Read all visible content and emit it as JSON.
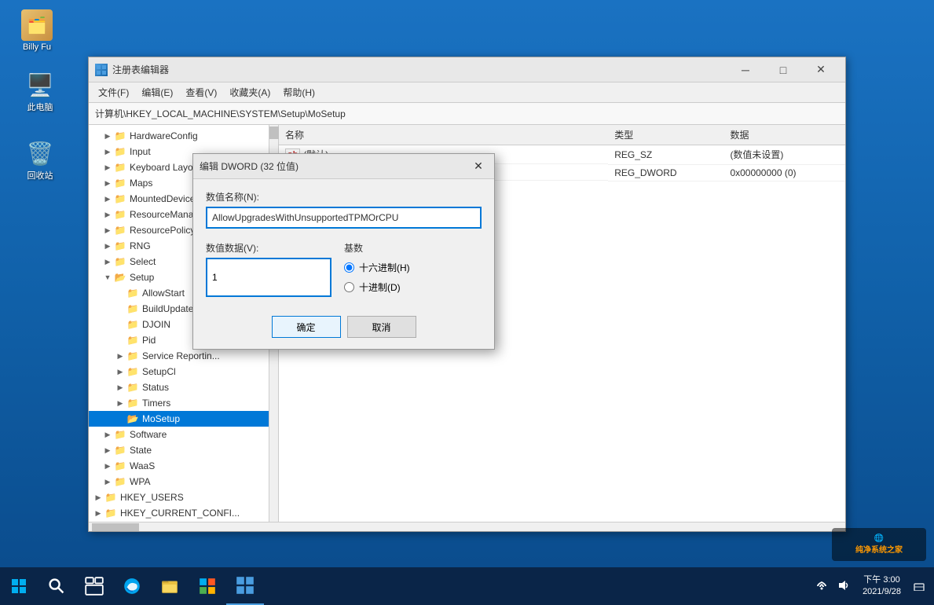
{
  "desktop": {
    "icons": [
      {
        "id": "computer",
        "label": "此电脑",
        "color": "#4a9de0"
      },
      {
        "id": "recycle",
        "label": "回收站",
        "color": "#888"
      }
    ],
    "user": "Billy Fu"
  },
  "registry_window": {
    "title": "注册表编辑器",
    "address": "计算机\\HKEY_LOCAL_MACHINE\\SYSTEM\\Setup\\MoSetup",
    "menu": [
      "文件(F)",
      "编辑(E)",
      "查看(V)",
      "收藏夹(A)",
      "帮助(H)"
    ],
    "columns": [
      "名称",
      "类型",
      "数据"
    ],
    "rows": [
      {
        "name": "(默认)",
        "type": "REG_SZ",
        "data": "(数值未设置)"
      },
      {
        "name": "AllowUpgradesWithUnsupportedTPMOrCPU",
        "type": "REG_DWORD",
        "data": "0x00000000 (0)"
      }
    ],
    "tree": {
      "items": [
        {
          "label": "HardwareConfig",
          "indent": 1,
          "arrow": "▶"
        },
        {
          "label": "Input",
          "indent": 1,
          "arrow": "▶"
        },
        {
          "label": "Keyboard Layout",
          "indent": 1,
          "arrow": "▶"
        },
        {
          "label": "Maps",
          "indent": 1,
          "arrow": "▶"
        },
        {
          "label": "MountedDevices",
          "indent": 1,
          "arrow": "▶"
        },
        {
          "label": "ResourceManager",
          "indent": 1,
          "arrow": "▶"
        },
        {
          "label": "ResourcePolicySto...",
          "indent": 1,
          "arrow": "▶"
        },
        {
          "label": "RNG",
          "indent": 1,
          "arrow": "▶"
        },
        {
          "label": "Select",
          "indent": 1,
          "arrow": "▶"
        },
        {
          "label": "Setup",
          "indent": 1,
          "arrow": "▼"
        },
        {
          "label": "AllowStart",
          "indent": 2,
          "arrow": ""
        },
        {
          "label": "BuildUpdate",
          "indent": 2,
          "arrow": ""
        },
        {
          "label": "DJOIN",
          "indent": 2,
          "arrow": ""
        },
        {
          "label": "Pid",
          "indent": 2,
          "arrow": ""
        },
        {
          "label": "Service Reportin...",
          "indent": 2,
          "arrow": "▶"
        },
        {
          "label": "SetupCl",
          "indent": 2,
          "arrow": "▶"
        },
        {
          "label": "Status",
          "indent": 2,
          "arrow": "▶"
        },
        {
          "label": "Timers",
          "indent": 2,
          "arrow": "▶"
        },
        {
          "label": "MoSetup",
          "indent": 2,
          "arrow": "",
          "selected": true
        },
        {
          "label": "Software",
          "indent": 1,
          "arrow": "▶"
        },
        {
          "label": "State",
          "indent": 1,
          "arrow": "▶"
        },
        {
          "label": "WaaS",
          "indent": 1,
          "arrow": "▶"
        },
        {
          "label": "WPA",
          "indent": 1,
          "arrow": "▶"
        },
        {
          "label": "HKEY_USERS",
          "indent": 0,
          "arrow": "▶"
        },
        {
          "label": "HKEY_CURRENT_CONFI...",
          "indent": 0,
          "arrow": "▶"
        }
      ]
    }
  },
  "dialog": {
    "title": "编辑 DWORD (32 位值)",
    "name_label": "数值名称(N):",
    "name_value": "AllowUpgradesWithUnsupportedTPMOrCPU",
    "data_label": "数值数据(V):",
    "data_value": "1",
    "base_label": "基数",
    "radio_hex": "十六进制(H)",
    "radio_dec": "十进制(D)",
    "btn_ok": "确定",
    "btn_cancel": "取消"
  },
  "taskbar": {
    "time": "...",
    "watermark": "纯净系统之家"
  },
  "icons": {
    "folder": "📁",
    "reg_entry": "🔵",
    "default_entry": "ab"
  }
}
